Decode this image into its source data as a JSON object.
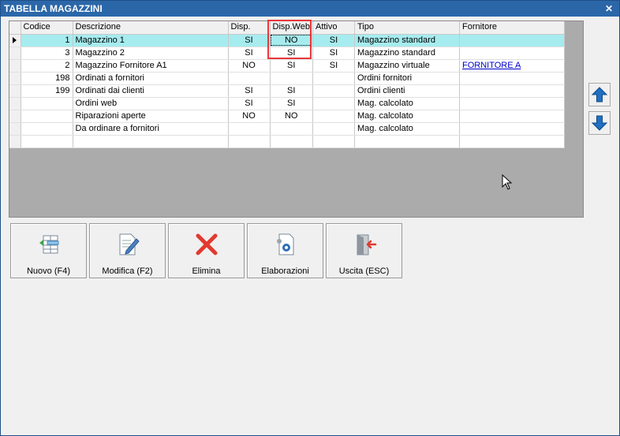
{
  "window": {
    "title": "TABELLA MAGAZZINI",
    "close_glyph": "✕"
  },
  "grid": {
    "columns": [
      "Codice",
      "Descrizione",
      "Disp.",
      "Disp.Web",
      "Attivo",
      "Tipo",
      "Fornitore"
    ],
    "rows": [
      {
        "codice": "1",
        "descrizione": "Magazzino 1",
        "disp": "SI",
        "disp_web": "NO",
        "attivo": "SI",
        "tipo": "Magazzino standard",
        "fornitore": ""
      },
      {
        "codice": "3",
        "descrizione": "Magazzino 2",
        "disp": "SI",
        "disp_web": "SI",
        "attivo": "SI",
        "tipo": "Magazzino standard",
        "fornitore": ""
      },
      {
        "codice": "2",
        "descrizione": "Magazzino Fornitore A1",
        "disp": "NO",
        "disp_web": "SI",
        "attivo": "SI",
        "tipo": "Magazzino virtuale",
        "fornitore": "FORNITORE A"
      },
      {
        "codice": "198",
        "descrizione": "Ordinati a fornitori",
        "disp": "",
        "disp_web": "",
        "attivo": "",
        "tipo": "Ordini fornitori",
        "fornitore": ""
      },
      {
        "codice": "199",
        "descrizione": "Ordinati dai clienti",
        "disp": "SI",
        "disp_web": "SI",
        "attivo": "",
        "tipo": "Ordini clienti",
        "fornitore": ""
      },
      {
        "codice": "",
        "descrizione": "Ordini web",
        "disp": "SI",
        "disp_web": "SI",
        "attivo": "",
        "tipo": "Mag. calcolato",
        "fornitore": ""
      },
      {
        "codice": "",
        "descrizione": "Riparazioni aperte",
        "disp": "NO",
        "disp_web": "NO",
        "attivo": "",
        "tipo": "Mag. calcolato",
        "fornitore": ""
      },
      {
        "codice": "",
        "descrizione": "Da ordinare a fornitori",
        "disp": "",
        "disp_web": "",
        "attivo": "",
        "tipo": "Mag. calcolato",
        "fornitore": ""
      },
      {
        "codice": "",
        "descrizione": "",
        "disp": "",
        "disp_web": "",
        "attivo": "",
        "tipo": "",
        "fornitore": ""
      }
    ]
  },
  "toolbar": {
    "nuovo": "Nuovo (F4)",
    "modifica": "Modifica (F2)",
    "elimina": "Elimina",
    "elaborazioni": "Elaborazioni",
    "uscita": "Uscita (ESC)"
  },
  "icons": {
    "new": "table-add-icon",
    "edit": "document-edit-icon",
    "delete": "delete-x-icon",
    "process": "gear-document-icon",
    "exit": "exit-door-icon",
    "up": "arrow-up-icon",
    "down": "arrow-down-icon"
  },
  "colors": {
    "title_bar": "#2b67a8",
    "selected_row": "#a6ecef",
    "highlight": "#e8383b",
    "arrow": "#1f6fc2",
    "delete": "#e2392f"
  }
}
